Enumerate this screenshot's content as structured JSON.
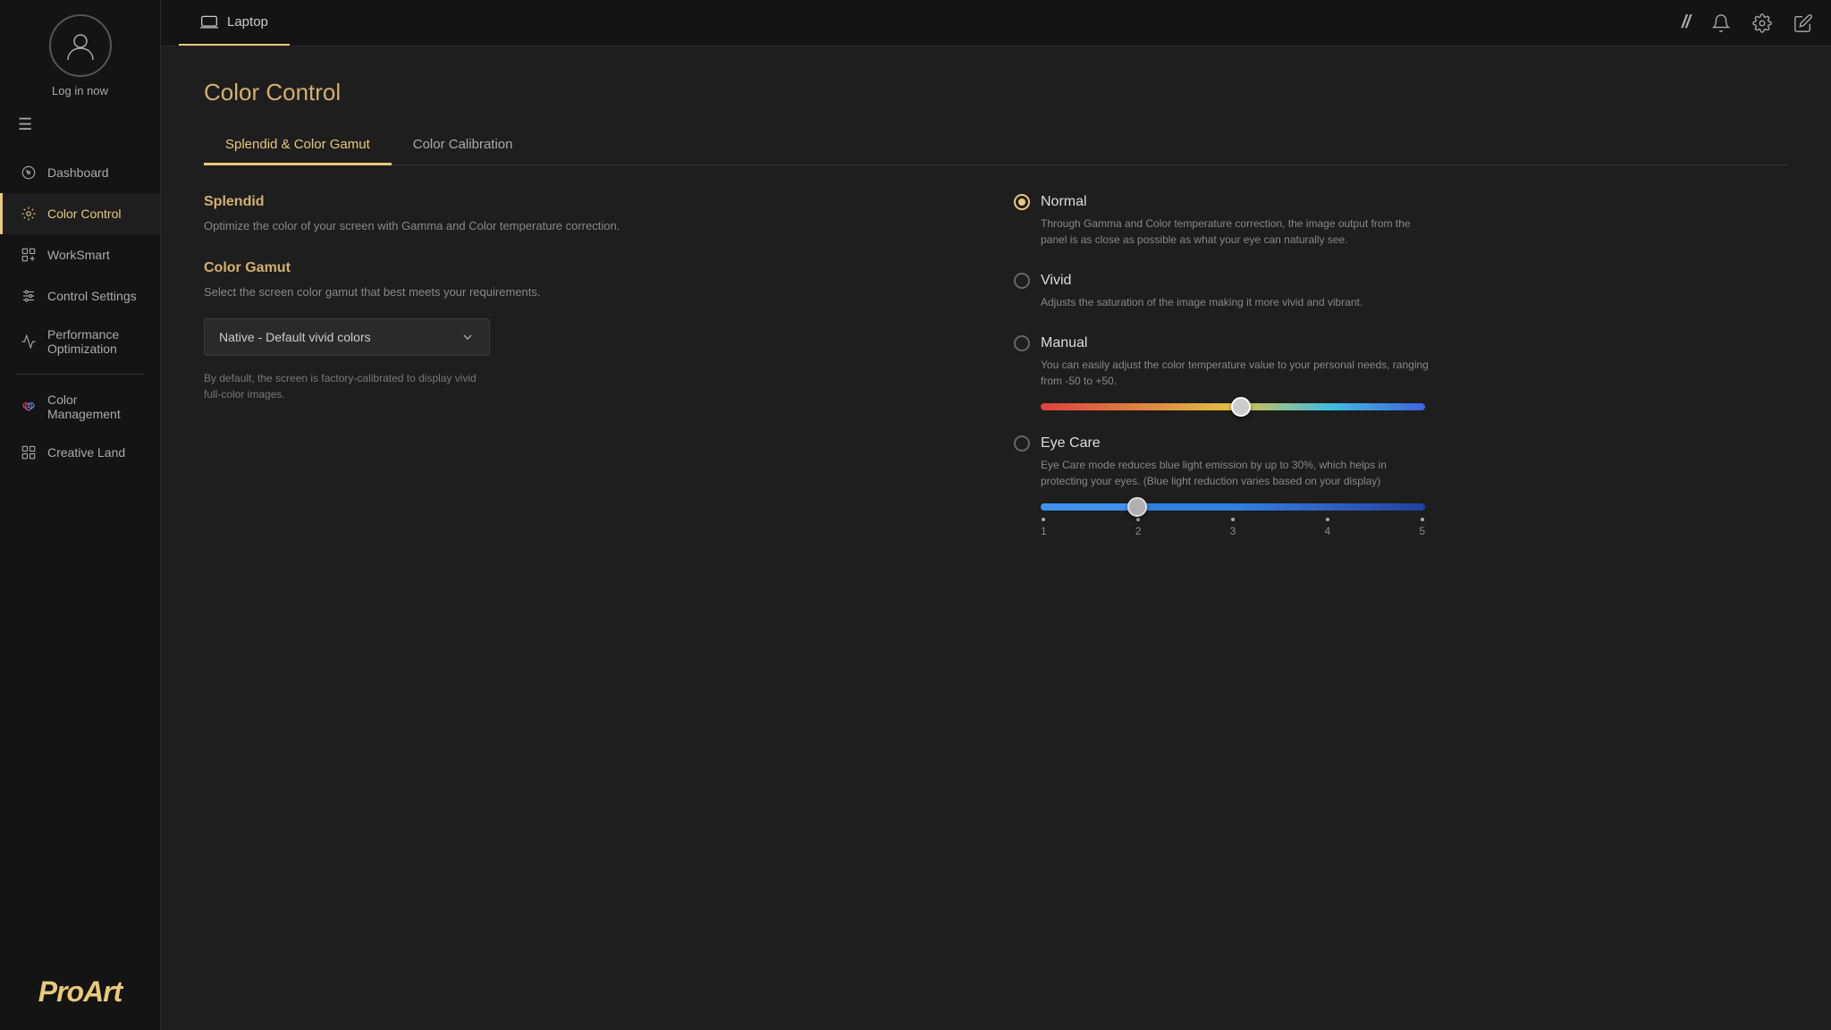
{
  "sidebar": {
    "login_label": "Log in now",
    "menu_icon": "☰",
    "nav_items": [
      {
        "id": "dashboard",
        "label": "Dashboard",
        "icon": "dashboard"
      },
      {
        "id": "color-control",
        "label": "Color Control",
        "icon": "color-control",
        "active": true
      },
      {
        "id": "worksmart",
        "label": "WorkSmart",
        "icon": "worksmart"
      },
      {
        "id": "control-settings",
        "label": "Control Settings",
        "icon": "control-settings"
      },
      {
        "id": "performance",
        "label": "Performance Optimization",
        "icon": "performance"
      },
      {
        "id": "color-management",
        "label": "Color Management",
        "icon": "color-management"
      },
      {
        "id": "creative-land",
        "label": "Creative Land",
        "icon": "creative-land"
      }
    ],
    "logo": "ProArt"
  },
  "topbar": {
    "tab_label": "Laptop",
    "tab_icon": "laptop"
  },
  "page": {
    "title": "Color Control",
    "tabs": [
      {
        "id": "splendid",
        "label": "Splendid & Color Gamut",
        "active": true
      },
      {
        "id": "calibration",
        "label": "Color Calibration",
        "active": false
      }
    ]
  },
  "left": {
    "splendid": {
      "title": "Splendid",
      "description": "Optimize the color of your screen with Gamma and Color temperature correction."
    },
    "color_gamut": {
      "title": "Color Gamut",
      "description": "Select the screen color gamut that best meets your requirements.",
      "dropdown_value": "Native - Default vivid colors",
      "dropdown_note": "By default, the screen is factory-calibrated to display vivid full-color images."
    }
  },
  "right": {
    "options": [
      {
        "id": "normal",
        "label": "Normal",
        "description": "Through Gamma and Color temperature correction, the image output from the panel is as close as possible as what your eye can naturally see.",
        "selected": true,
        "has_slider": false
      },
      {
        "id": "vivid",
        "label": "Vivid",
        "description": "Adjusts the saturation of the image making it more vivid and vibrant.",
        "selected": false,
        "has_slider": false
      },
      {
        "id": "manual",
        "label": "Manual",
        "description": "You can easily adjust the color temperature value to your personal needs, ranging from -50 to +50.",
        "selected": false,
        "has_slider": true,
        "slider_type": "temperature"
      },
      {
        "id": "eye-care",
        "label": "Eye Care",
        "description": "Eye Care mode reduces blue light emission by up to 30%, which helps in protecting your eyes. (Blue light reduction varies based on your display)",
        "selected": false,
        "has_slider": true,
        "slider_type": "eyecare",
        "ticks": [
          "1",
          "2",
          "3",
          "4",
          "5"
        ],
        "slider_value": 2
      }
    ]
  }
}
